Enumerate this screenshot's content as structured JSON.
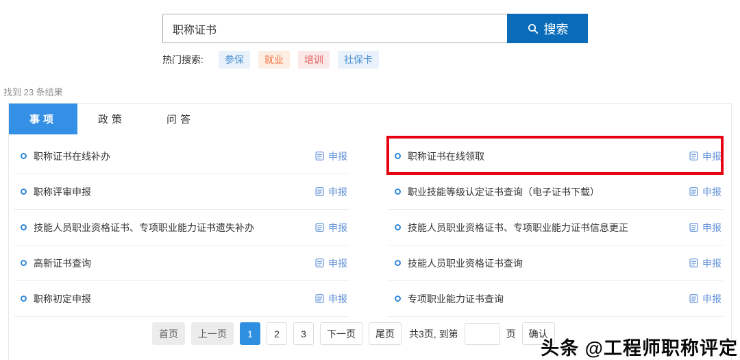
{
  "search": {
    "query": "职称证书",
    "button_label": "搜索",
    "hot_label": "热门搜索:",
    "hot_tags": [
      {
        "label": "参保",
        "color": "#4a8fd4",
        "bg": "#e9f2fb"
      },
      {
        "label": "就业",
        "color": "#f2703a",
        "bg": "#fdeee4"
      },
      {
        "label": "培训",
        "color": "#e25b5b",
        "bg": "#fbe9e9"
      },
      {
        "label": "社保卡",
        "color": "#4a8fd4",
        "bg": "#e9f2fb"
      }
    ]
  },
  "results": {
    "count_text": "找到 23 条结果",
    "tabs": [
      {
        "label": "事项",
        "active": true
      },
      {
        "label": "政策",
        "active": false
      },
      {
        "label": "问答",
        "active": false
      }
    ],
    "apply_label": "申报",
    "columns": {
      "left": [
        "职称证书在线补办",
        "职称评审申报",
        "技能人员职业资格证书、专项职业能力证书遗失补办",
        "高新证书查询",
        "职称初定申报"
      ],
      "right": [
        "职称证书在线领取",
        "职业技能等级认定证书查询（电子证书下载）",
        "技能人员职业资格证书、专项职业能力证书信息更正",
        "技能人员职业资格证书查询",
        "专项职业能力证书查询"
      ]
    },
    "highlighted_item": "职称证书在线领取"
  },
  "pagination": {
    "first_label": "首页",
    "prev_label": "上一页",
    "pages": [
      "1",
      "2",
      "3"
    ],
    "active_page": "1",
    "next_label": "下一页",
    "last_label": "尾页",
    "summary_text": "共3页, 到第",
    "jump_value": "",
    "page_unit": "页",
    "confirm_label": "确认"
  },
  "watermark": "头条 @工程师职称评定",
  "colors": {
    "search_button": "#0a6cb8",
    "tab_active": "#3390e4",
    "link_blue": "#6292d8",
    "highlight_red": "#e60012",
    "page_active": "#2e8fe0"
  }
}
